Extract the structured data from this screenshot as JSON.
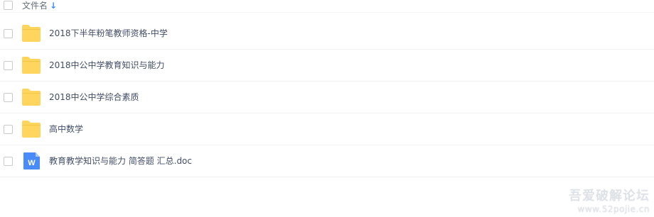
{
  "header": {
    "column_label": "文件名",
    "sort_icon": "arrow-down-icon",
    "sort_color": "#3b8cff"
  },
  "files": [
    {
      "name": "2018下半年粉笔教师资格-中学",
      "type": "folder",
      "icon": "folder-icon"
    },
    {
      "name": "2018中公中学教育知识与能力",
      "type": "folder",
      "icon": "folder-icon"
    },
    {
      "name": "2018中公中学综合素质",
      "type": "folder",
      "icon": "folder-icon"
    },
    {
      "name": "高中数学",
      "type": "folder",
      "icon": "folder-icon"
    },
    {
      "name": "教育教学知识与能力 简答题 汇总.doc",
      "type": "doc",
      "icon": "word-doc-icon"
    }
  ],
  "colors": {
    "folder": "#ffd55e",
    "word": "#4a8cf7",
    "text": "#424e67"
  },
  "watermark": {
    "title": "吾爱破解论坛",
    "url": "www.52pojie.cn"
  }
}
